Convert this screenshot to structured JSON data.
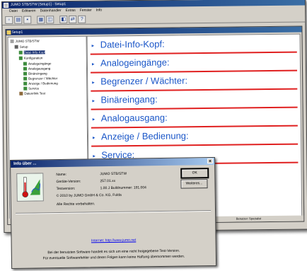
{
  "main_window": {
    "title": "JUMO STB/STW [Setup1] - Setup1",
    "menu": [
      "Datei",
      "Editieren",
      "Datenhandler",
      "Extras",
      "Fenster",
      "Info"
    ],
    "toolbar_icons": [
      "new-icon",
      "open-icon",
      "save-icon",
      "print-icon",
      "copy-icon",
      "paste-icon",
      "transfer-icon",
      "help-icon"
    ],
    "status_text": "Benutzer: Spezialist"
  },
  "child_window": {
    "title": "Setup1"
  },
  "tree": {
    "items": [
      {
        "label": "JUMO STB/STW",
        "level": 0
      },
      {
        "label": "Setup",
        "level": 1
      },
      {
        "label": "Datei-Info-Kopf",
        "level": 2,
        "selected": true
      },
      {
        "label": "Konfiguration",
        "level": 2
      },
      {
        "label": "Analogeingänge",
        "level": 3
      },
      {
        "label": "Analogausgang",
        "level": 3
      },
      {
        "label": "Binäreingang",
        "level": 3
      },
      {
        "label": "Begrenzer / Wächter",
        "level": 3
      },
      {
        "label": "Anzeige / Bedienung",
        "level": 3
      },
      {
        "label": "Service",
        "level": 3
      },
      {
        "label": "Datenrlink Test",
        "level": 2
      }
    ]
  },
  "content": {
    "sections": [
      "Datei-Info-Kopf:",
      "Analogeingänge:",
      "Begrenzer / Wächter:",
      "Binäreingang:",
      "Analogausgang:",
      "Anzeige / Bedienung:",
      "Service:"
    ]
  },
  "dialog": {
    "title": "Info über ...",
    "close_label": "x",
    "rows": [
      {
        "label": "Name:",
        "value": "JUMO STB/STW"
      },
      {
        "label": "Geräte-Version:",
        "value": "257.01.xx"
      },
      {
        "label": "Testversion:",
        "value": "1.00.J   Buildnummer: 191.004"
      }
    ],
    "copyright": "© 2010 by JUMO GmbH & Co. KG, Fulda",
    "rights": "Alle Rechte vorbehalten.",
    "ok_label": "OK",
    "more_label": "Weiteres...",
    "internet_link": "Internet: http://www.jumo.net",
    "note_line1": "Bei der benutzten Software handelt es sich um eine nicht freigegebene Test-Version.",
    "note_line2": "Für eventuelle Softwarefehler und deren Folgen kann keine Haftung übernommen werden."
  },
  "colors": {
    "title_bar": "#0a246a",
    "section_text": "#1a56c8",
    "section_rule": "#e02020",
    "window_face": "#d4d0c8"
  }
}
